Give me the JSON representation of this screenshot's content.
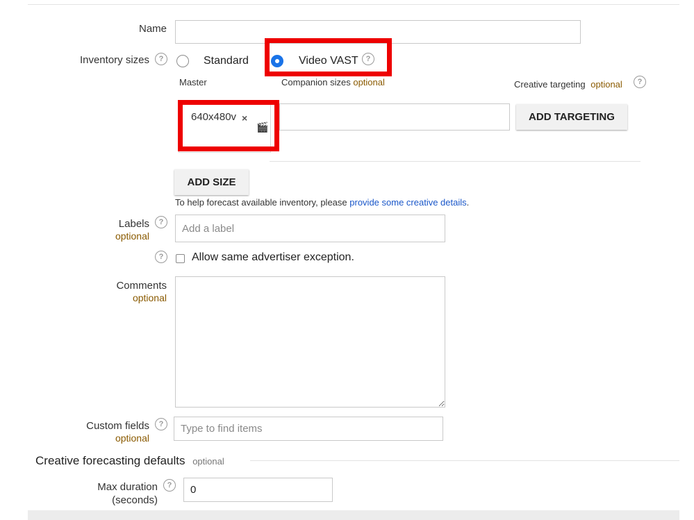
{
  "form": {
    "name_label": "Name",
    "name_value": "",
    "inventory_sizes_label": "Inventory sizes",
    "radio_standard_label": "Standard",
    "radio_video_label": "Video VAST",
    "master_label": "Master",
    "companion_label": "Companion sizes",
    "companion_optional": "optional",
    "creative_targeting_label": "Creative targeting",
    "creative_targeting_optional": "optional",
    "size_chip": "640x480v",
    "chip_remove": "×",
    "add_targeting_label": "ADD TARGETING",
    "add_size_label": "ADD SIZE",
    "forecast_hint": "To help forecast available inventory, please",
    "forecast_link": "provide some creative details",
    "forecast_end": ".",
    "labels_label": "Labels",
    "labels_optional": "optional",
    "labels_placeholder": "Add a label",
    "exception_label": "Allow same advertiser exception.",
    "comments_label": "Comments",
    "comments_optional": "optional",
    "custom_fields_label": "Custom fields",
    "custom_fields_optional": "optional",
    "custom_fields_placeholder": "Type to find items",
    "section_title": "Creative forecasting defaults",
    "section_optional": "optional",
    "max_duration_label_1": "Max duration",
    "max_duration_label_2": "(seconds)",
    "max_duration_value": "0",
    "help_glyph": "?",
    "video_icon": "🎬"
  },
  "colors": {
    "accent": "#1a73e8",
    "optional": "#8a5a00",
    "highlight": "#ee0000",
    "link": "#1a57c9"
  },
  "icons": [
    "help-icon",
    "video-clapper-icon",
    "close-icon"
  ]
}
